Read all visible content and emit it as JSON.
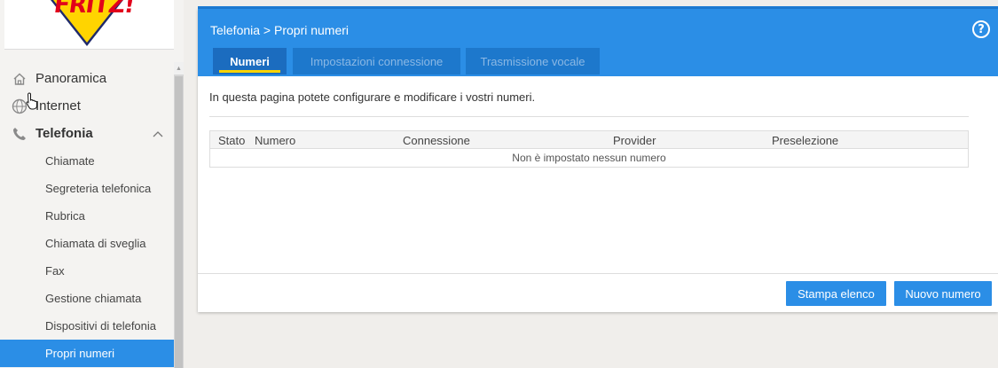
{
  "sidebar": {
    "logo_text": "FRITZ!",
    "items": [
      {
        "label": "Panoramica",
        "icon": "home-icon"
      },
      {
        "label": "Internet",
        "icon": "globe-icon"
      },
      {
        "label": "Telefonia",
        "icon": "phone-icon",
        "expanded": true
      }
    ],
    "subitems": [
      {
        "label": "Chiamate"
      },
      {
        "label": "Segreteria telefonica"
      },
      {
        "label": "Rubrica"
      },
      {
        "label": "Chiamata di sveglia"
      },
      {
        "label": "Fax"
      },
      {
        "label": "Gestione chiamata"
      },
      {
        "label": "Dispositivi di telefonia"
      },
      {
        "label": "Propri numeri",
        "active": true
      }
    ]
  },
  "header": {
    "breadcrumb": "Telefonia > Propri numeri",
    "help_glyph": "?"
  },
  "tabs": [
    {
      "label": "Numeri",
      "active": true
    },
    {
      "label": "Impostazioni connessione"
    },
    {
      "label": "Trasmissione vocale"
    }
  ],
  "main": {
    "intro": "In questa pagina potete configurare e modificare i vostri numeri.",
    "table": {
      "columns": [
        "Stato",
        "Numero",
        "Connessione",
        "Provider",
        "Preselezione"
      ],
      "empty_message": "Non è impostato nessun numero"
    }
  },
  "buttons": {
    "print_label": "Stampa elenco",
    "new_label": "Nuovo numero"
  },
  "colors": {
    "accent": "#2b8ee6",
    "tab_active": "#1b6cbf",
    "tab_indicator": "#ffd400"
  }
}
